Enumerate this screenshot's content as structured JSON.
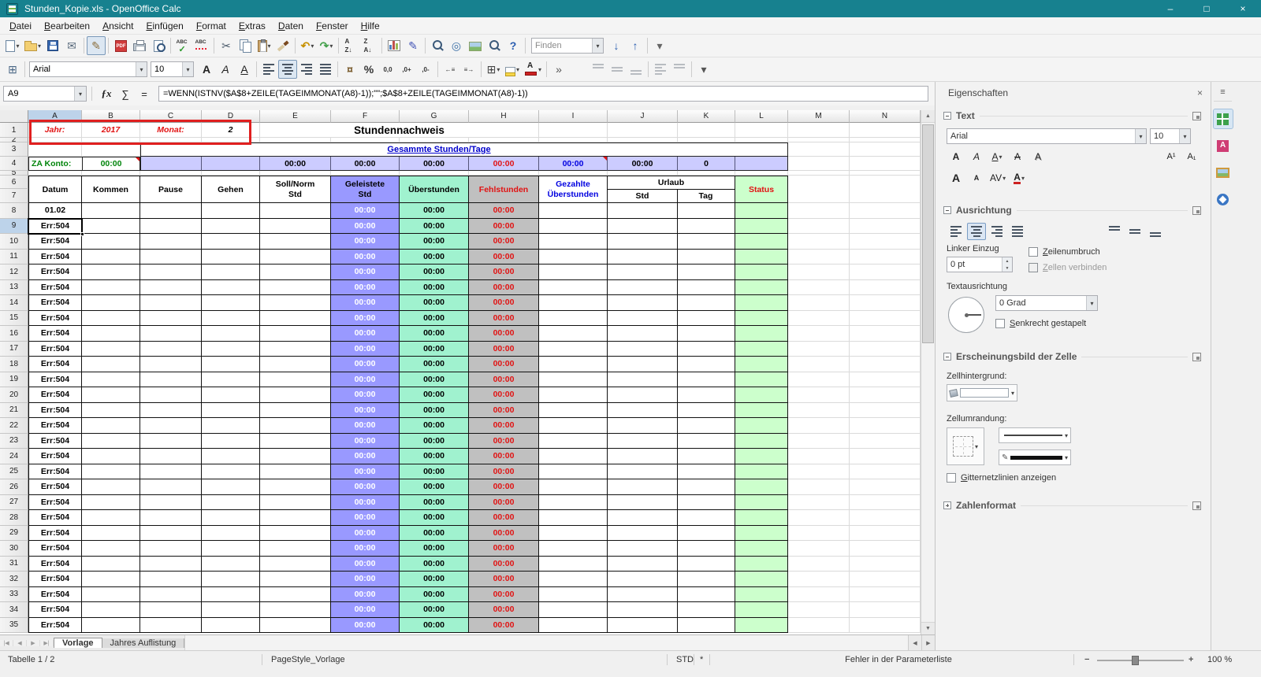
{
  "window": {
    "title": "Stunden_Kopie.xls - OpenOffice Calc"
  },
  "icons": {
    "minimize": "–",
    "maximize": "□",
    "close": "×",
    "dropdown": "▾",
    "more": "▾",
    "overflow": "»",
    "fx": "ƒx",
    "sum": "∑",
    "equals": "=",
    "find_down": "↓",
    "find_up": "↑",
    "nav_first": "|◀",
    "nav_prev": "◀",
    "nav_next": "▶",
    "nav_last": "▶|",
    "scroll_up": "▲",
    "scroll_down": "▼",
    "scroll_left": "◀",
    "scroll_right": "▶",
    "spin_up": "▲",
    "spin_down": "▼",
    "sidebar_menu": "≡",
    "minus": "−",
    "plus": "+",
    "pen": "✎"
  },
  "colors": {
    "title_bar": "#17818f",
    "geleistete_fill": "#9999ff",
    "summary_fill": "#ccccff",
    "ueberstunden_fill": "#a0f2cf",
    "fehlstunden_fill": "#c0c0c0",
    "status_fill": "#ccffcc",
    "error_red": "#e11212",
    "blue_text": "#0000e0",
    "green_text": "#00840a",
    "annotation_red": "#e01f1f"
  },
  "menu": {
    "items": [
      "Datei",
      "Bearbeiten",
      "Ansicht",
      "Einfügen",
      "Format",
      "Extras",
      "Daten",
      "Fenster",
      "Hilfe"
    ]
  },
  "toolbar_standard": {
    "find_value": "Finden",
    "buttons": [
      {
        "name": "new-document",
        "kind": "page",
        "dd": true
      },
      {
        "name": "open-document",
        "kind": "folder",
        "dd": true
      },
      {
        "name": "save",
        "kind": "floppy"
      },
      {
        "name": "send-email",
        "kind": "glyph",
        "glyph": "✉",
        "color": "#5a6b7d"
      },
      {
        "sep": true
      },
      {
        "name": "edit-file",
        "kind": "glyph",
        "glyph": "✎",
        "color": "#8a6d3b",
        "pressed": true
      },
      {
        "sep": true
      },
      {
        "name": "export-pdf",
        "kind": "pdf"
      },
      {
        "name": "print",
        "kind": "printer"
      },
      {
        "name": "page-preview",
        "kind": "preview"
      },
      {
        "sep": true
      },
      {
        "name": "spelling",
        "kind": "abc-check"
      },
      {
        "name": "auto-spellcheck",
        "kind": "abc-red"
      },
      {
        "sep": true
      },
      {
        "name": "cut",
        "kind": "glyph",
        "glyph": "✂",
        "color": "#4a5a6a"
      },
      {
        "name": "copy",
        "kind": "copy"
      },
      {
        "name": "paste",
        "kind": "clipboard",
        "dd": true
      },
      {
        "name": "format-paintbrush",
        "kind": "brush"
      },
      {
        "sep": true
      },
      {
        "name": "undo",
        "kind": "glyph",
        "glyph": "↶",
        "color": "#c79100",
        "bold": true,
        "dd": true
      },
      {
        "name": "redo",
        "kind": "glyph",
        "glyph": "↷",
        "color": "#44a04c",
        "bold": true,
        "dd": true
      },
      {
        "sep": true
      },
      {
        "name": "sort-ascending",
        "kind": "sort-az"
      },
      {
        "name": "sort-descending",
        "kind": "sort-za"
      },
      {
        "sep": true
      },
      {
        "name": "insert-chart",
        "kind": "chart"
      },
      {
        "name": "show-draw-functions",
        "kind": "glyph",
        "glyph": "✎",
        "color": "#3f51b5"
      },
      {
        "sep": true
      },
      {
        "name": "find-replace",
        "kind": "mag"
      },
      {
        "name": "navigator",
        "kind": "glyph",
        "glyph": "◎",
        "color": "#3a6ea5"
      },
      {
        "name": "gallery",
        "kind": "gallery"
      },
      {
        "name": "zoom",
        "kind": "mag"
      },
      {
        "name": "help",
        "kind": "glyph",
        "glyph": "?",
        "color": "#2a5db0",
        "bold": true
      },
      {
        "sep": true
      }
    ]
  },
  "toolbar_format": {
    "font_name": "Arial",
    "font_size": "10",
    "lead_buttons": [
      {
        "name": "sidebar-toggle",
        "kind": "glyph",
        "glyph": "⊞",
        "color": "#4a6785"
      },
      {
        "sep": true
      }
    ],
    "buttons": [
      {
        "name": "bold",
        "kind": "glyph",
        "glyph": "A",
        "color": "#222",
        "bold": true
      },
      {
        "name": "italic",
        "kind": "glyph",
        "glyph": "A",
        "color": "#222",
        "italic": true
      },
      {
        "name": "underline",
        "kind": "glyph",
        "glyph": "A",
        "color": "#222",
        "underline": true
      },
      {
        "sep": true
      },
      {
        "name": "align-left",
        "kind": "bars",
        "variant": "left"
      },
      {
        "name": "align-center",
        "kind": "bars",
        "variant": "center",
        "pressed": true
      },
      {
        "name": "align-right",
        "kind": "bars",
        "variant": "right"
      },
      {
        "name": "justify",
        "kind": "bars",
        "variant": "justify"
      },
      {
        "sep": true
      },
      {
        "name": "number-format-currency",
        "kind": "glyph",
        "glyph": "¤",
        "color": "#7a5c2e",
        "bold": true
      },
      {
        "name": "number-format-percent",
        "kind": "glyph",
        "glyph": "%",
        "color": "#333",
        "bold": true
      },
      {
        "name": "number-format-standard",
        "kind": "txt",
        "glyph": "0,0"
      },
      {
        "name": "add-decimal-place",
        "kind": "txt",
        "glyph": ",0+"
      },
      {
        "name": "delete-decimal-place",
        "kind": "txt",
        "glyph": ",0-"
      },
      {
        "sep": true
      },
      {
        "name": "decrease-indent",
        "kind": "txt",
        "glyph": "←≡"
      },
      {
        "name": "increase-indent",
        "kind": "txt",
        "glyph": "≡→"
      },
      {
        "sep": true
      },
      {
        "name": "borders",
        "kind": "glyph",
        "glyph": "⊞",
        "color": "#444",
        "dd": true
      },
      {
        "name": "background-color",
        "kind": "swatch",
        "dd": true
      },
      {
        "name": "font-color",
        "kind": "fontcolor",
        "dd": true
      },
      {
        "sep": true
      },
      {
        "name": "formatting-overflow",
        "kind": "glyph",
        "glyph": "»",
        "color": "#555"
      },
      {
        "gap": 26
      },
      {
        "name": "align-top",
        "kind": "bars",
        "variant": "vtop",
        "disabled": true
      },
      {
        "name": "center-vertically",
        "kind": "bars",
        "variant": "vmid",
        "disabled": true
      },
      {
        "name": "align-bottom",
        "kind": "bars",
        "variant": "vbot",
        "disabled": true
      },
      {
        "sep": true
      },
      {
        "name": "text-direction-left-to-right",
        "kind": "bars",
        "variant": "left",
        "disabled": true
      },
      {
        "name": "text-direction-top-to-bottom",
        "kind": "bars",
        "variant": "vtop",
        "disabled": true
      },
      {
        "sep": true
      },
      {
        "name": "more-options",
        "kind": "glyph",
        "glyph": "▾",
        "color": "#555"
      }
    ]
  },
  "formula_bar": {
    "cell_reference": "A9",
    "formula": "=WENN(ISTNV($A$8+ZEILE(TAGEIMMONAT(A8)-1));\"\";$A$8+ZEILE(TAGEIMMONAT(A8)-1))"
  },
  "grid": {
    "column_letters": [
      "A",
      "B",
      "C",
      "D",
      "E",
      "F",
      "G",
      "H",
      "I",
      "J",
      "K",
      "L",
      "M",
      "N"
    ],
    "selection": {
      "column": "A",
      "row": "9"
    },
    "top": {
      "jahr_label": "Jahr:",
      "jahr_value": "2017",
      "monat_label": "Monat:",
      "monat_value": "2",
      "main_title": "Stundennachweis",
      "summary_title": "Gesammte Stunden/Tage",
      "za_label": "ZA Konto:",
      "za_value": "00:00",
      "summary_values": {
        "soll": "00:00",
        "geleistete": "00:00",
        "ueberstunden": "00:00",
        "fehlstunden": "00:00",
        "gezahlte": "00:00",
        "urlaub_std": "00:00",
        "urlaub_tag": "0"
      }
    },
    "header": {
      "datum": "Datum",
      "kommen": "Kommen",
      "pause": "Pause",
      "gehen": "Gehen",
      "soll": "Soll/Norm\nStd",
      "geleistete": "Geleistete\nStd",
      "ueberstunden": "Überstunden",
      "fehlstunden": "Fehlstunden",
      "gezahlte": "Gezahlte\nÜberstunden",
      "urlaub": "Urlaub",
      "urlaub_std": "Std",
      "urlaub_tag": "Tag",
      "status": "Status"
    },
    "rows": [
      {
        "n": "8",
        "datum": "01.02",
        "geleistete": "00:00",
        "ueberstunden": "00:00",
        "fehlstunden": "00:00"
      },
      {
        "n": "9",
        "datum": "Err:504",
        "geleistete": "00:00",
        "ueberstunden": "00:00",
        "fehlstunden": "00:00"
      },
      {
        "n": "10",
        "datum": "Err:504",
        "geleistete": "00:00",
        "ueberstunden": "00:00",
        "fehlstunden": "00:00"
      },
      {
        "n": "11",
        "datum": "Err:504",
        "geleistete": "00:00",
        "ueberstunden": "00:00",
        "fehlstunden": "00:00"
      },
      {
        "n": "12",
        "datum": "Err:504",
        "geleistete": "00:00",
        "ueberstunden": "00:00",
        "fehlstunden": "00:00"
      },
      {
        "n": "13",
        "datum": "Err:504",
        "geleistete": "00:00",
        "ueberstunden": "00:00",
        "fehlstunden": "00:00"
      },
      {
        "n": "14",
        "datum": "Err:504",
        "geleistete": "00:00",
        "ueberstunden": "00:00",
        "fehlstunden": "00:00"
      },
      {
        "n": "15",
        "datum": "Err:504",
        "geleistete": "00:00",
        "ueberstunden": "00:00",
        "fehlstunden": "00:00"
      },
      {
        "n": "16",
        "datum": "Err:504",
        "geleistete": "00:00",
        "ueberstunden": "00:00",
        "fehlstunden": "00:00"
      },
      {
        "n": "17",
        "datum": "Err:504",
        "geleistete": "00:00",
        "ueberstunden": "00:00",
        "fehlstunden": "00:00"
      },
      {
        "n": "18",
        "datum": "Err:504",
        "geleistete": "00:00",
        "ueberstunden": "00:00",
        "fehlstunden": "00:00"
      },
      {
        "n": "19",
        "datum": "Err:504",
        "geleistete": "00:00",
        "ueberstunden": "00:00",
        "fehlstunden": "00:00"
      },
      {
        "n": "20",
        "datum": "Err:504",
        "geleistete": "00:00",
        "ueberstunden": "00:00",
        "fehlstunden": "00:00"
      },
      {
        "n": "21",
        "datum": "Err:504",
        "geleistete": "00:00",
        "ueberstunden": "00:00",
        "fehlstunden": "00:00"
      },
      {
        "n": "22",
        "datum": "Err:504",
        "geleistete": "00:00",
        "ueberstunden": "00:00",
        "fehlstunden": "00:00"
      },
      {
        "n": "23",
        "datum": "Err:504",
        "geleistete": "00:00",
        "ueberstunden": "00:00",
        "fehlstunden": "00:00"
      },
      {
        "n": "24",
        "datum": "Err:504",
        "geleistete": "00:00",
        "ueberstunden": "00:00",
        "fehlstunden": "00:00"
      },
      {
        "n": "25",
        "datum": "Err:504",
        "geleistete": "00:00",
        "ueberstunden": "00:00",
        "fehlstunden": "00:00"
      },
      {
        "n": "26",
        "datum": "Err:504",
        "geleistete": "00:00",
        "ueberstunden": "00:00",
        "fehlstunden": "00:00"
      },
      {
        "n": "27",
        "datum": "Err:504",
        "geleistete": "00:00",
        "ueberstunden": "00:00",
        "fehlstunden": "00:00"
      },
      {
        "n": "28",
        "datum": "Err:504",
        "geleistete": "00:00",
        "ueberstunden": "00:00",
        "fehlstunden": "00:00"
      },
      {
        "n": "29",
        "datum": "Err:504",
        "geleistete": "00:00",
        "ueberstunden": "00:00",
        "fehlstunden": "00:00"
      },
      {
        "n": "30",
        "datum": "Err:504",
        "geleistete": "00:00",
        "ueberstunden": "00:00",
        "fehlstunden": "00:00"
      },
      {
        "n": "31",
        "datum": "Err:504",
        "geleistete": "00:00",
        "ueberstunden": "00:00",
        "fehlstunden": "00:00"
      },
      {
        "n": "32",
        "datum": "Err:504",
        "geleistete": "00:00",
        "ueberstunden": "00:00",
        "fehlstunden": "00:00"
      },
      {
        "n": "33",
        "datum": "Err:504",
        "geleistete": "00:00",
        "ueberstunden": "00:00",
        "fehlstunden": "00:00"
      },
      {
        "n": "34",
        "datum": "Err:504",
        "geleistete": "00:00",
        "ueberstunden": "00:00",
        "fehlstunden": "00:00"
      },
      {
        "n": "35",
        "datum": "Err:504",
        "geleistete": "00:00",
        "ueberstunden": "00:00",
        "fehlstunden": "00:00"
      }
    ]
  },
  "sidebar": {
    "title": "Eigenschaften",
    "tabs": [
      {
        "name": "properties",
        "active": true
      },
      {
        "name": "styles"
      },
      {
        "name": "gallery"
      },
      {
        "name": "navigator"
      }
    ],
    "text_section": {
      "title": "Text",
      "font_name": "Arial",
      "font_size": "10",
      "row1": [
        {
          "name": "bold",
          "glyph": "A",
          "style": "b"
        },
        {
          "name": "italic",
          "glyph": "A",
          "style": "i"
        },
        {
          "name": "underline",
          "glyph": "A",
          "style": "u",
          "dd": true
        },
        {
          "name": "strikethrough",
          "glyph": "A",
          "style": "strike"
        },
        {
          "name": "shadow",
          "glyph": "A",
          "style": "sh"
        }
      ],
      "row1_right": [
        {
          "name": "superscript",
          "glyph": "A¹",
          "style": "sup"
        },
        {
          "name": "subscript",
          "glyph": "A₁",
          "style": "sub"
        }
      ],
      "row2": [
        {
          "name": "increase-font-size",
          "glyph": "A",
          "style": "inc"
        },
        {
          "name": "decrease-font-size",
          "glyph": "A",
          "style": "dec"
        },
        {
          "name": "character-spacing",
          "glyph": "AV",
          "dd": true
        },
        {
          "name": "sidebar-font-color",
          "glyph": "A",
          "style": "fc",
          "dd": true
        }
      ]
    },
    "align_section": {
      "title": "Ausrichtung",
      "horizontal_buttons": [
        {
          "name": "align-left",
          "kind": "bars",
          "variant": "left"
        },
        {
          "name": "align-center",
          "kind": "bars",
          "variant": "center",
          "pressed": true
        },
        {
          "name": "align-right",
          "kind": "bars",
          "variant": "right"
        },
        {
          "name": "align-justify",
          "kind": "bars",
          "variant": "justify"
        }
      ],
      "vertical_buttons": [
        {
          "name": "align-top",
          "kind": "bars",
          "variant": "vtop"
        },
        {
          "name": "center-vertically",
          "kind": "bars",
          "variant": "vmid"
        },
        {
          "name": "align-bottom",
          "kind": "bars",
          "variant": "vbot"
        }
      ],
      "left_indent_label": "Linker Einzug",
      "indent_value": "0 pt",
      "wrap_label": "Zeilenumbruch",
      "merge_label": "Zellen verbinden",
      "orientation_label": "Textausrichtung",
      "degree_value": "0 Grad",
      "stacked_label": "Senkrecht gestapelt"
    },
    "cell_section": {
      "title": "Erscheinungsbild der Zelle",
      "background_label": "Zellhintergrund:",
      "border_label": "Zellumrandung:",
      "gridlines_label": "Gitternetzlinien anzeigen"
    },
    "number_section": {
      "title": "Zahlenformat"
    }
  },
  "tabs": {
    "sheets": [
      "Vorlage",
      "Jahres Auflistung"
    ],
    "active": "Vorlage"
  },
  "status_bar": {
    "sheet": "Tabelle 1 / 2",
    "page_style": "PageStyle_Vorlage",
    "mode": "STD",
    "modified": "*",
    "message": "Fehler in der Parameterliste",
    "zoom_level": "100 %"
  }
}
